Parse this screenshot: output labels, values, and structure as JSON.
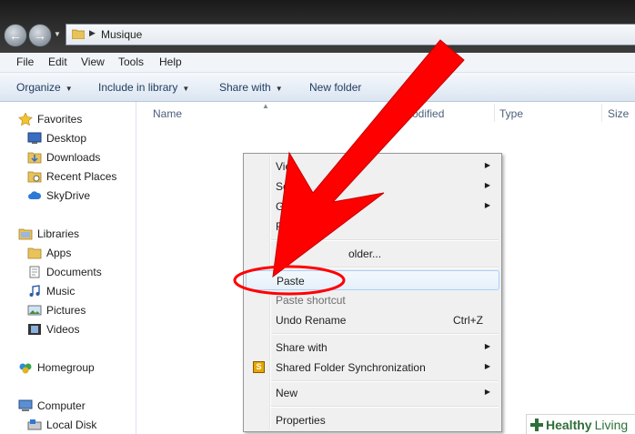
{
  "window": {
    "address": {
      "path_label": "Musique"
    }
  },
  "menubar": {
    "items": [
      "File",
      "Edit",
      "View",
      "Tools",
      "Help"
    ]
  },
  "toolbar": {
    "organize": "Organize",
    "include_in_library": "Include in library",
    "share_with": "Share with",
    "new_folder": "New folder"
  },
  "navigation": {
    "favorites": {
      "label": "Favorites",
      "items": [
        "Desktop",
        "Downloads",
        "Recent Places",
        "SkyDrive"
      ]
    },
    "libraries": {
      "label": "Libraries",
      "items": [
        "Apps",
        "Documents",
        "Music",
        "Pictures",
        "Videos"
      ]
    },
    "homegroup": "Homegroup",
    "computer": {
      "label": "Computer",
      "items": [
        "Local Disk"
      ]
    }
  },
  "filelist": {
    "columns": {
      "name": "Name",
      "modified": "odified",
      "type": "Type",
      "size": "Size"
    }
  },
  "context_menu": {
    "view": "Vie",
    "sort_by": "Sor",
    "group_by": "Gro",
    "refresh": "Ref",
    "customize": "Cus",
    "customize_tail": "older...",
    "paste": "Paste",
    "paste_shortcut": "Paste shortcut",
    "undo_rename": "Undo Rename",
    "undo_shortcut": "Ctrl+Z",
    "share_with": "Share with",
    "shared_folder_sync": "Shared Folder Synchronization",
    "new": "New",
    "properties": "Properties",
    "sfs_icon_letter": "S"
  },
  "annotation": {
    "arrow_color": "#ff0000",
    "highlight_target": "Paste"
  },
  "watermark": {
    "part1": "Healthy",
    "part2": "Living"
  },
  "colors": {
    "accent": "#1e3a5f",
    "highlight_border": "#aecff7",
    "annotation": "#ff0000"
  }
}
